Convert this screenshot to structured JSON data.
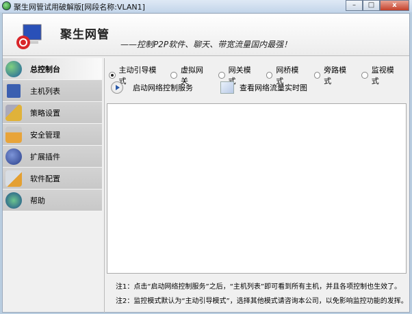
{
  "window": {
    "title": "聚生网管试用破解版[网段名称:VLAN1]",
    "minimize": "–",
    "maximize": "□",
    "close": "x"
  },
  "header": {
    "app_name": "聚生网管",
    "slogan": "——控制P2P软件、聊天、带宽流量国内最强！"
  },
  "sidebar": {
    "items": [
      {
        "label": "总控制台",
        "icon": "globe-icon",
        "color": "#2f7a3a"
      },
      {
        "label": "主机列表",
        "icon": "monitor-star-icon",
        "color": "#3b5fb0"
      },
      {
        "label": "策略设置",
        "icon": "keys-icon",
        "color": "#e0b23a"
      },
      {
        "label": "安全管理",
        "icon": "padlock-icon",
        "color": "#e8a43a"
      },
      {
        "label": "扩展插件",
        "icon": "plugin-icon",
        "color": "#3a57a8"
      },
      {
        "label": "软件配置",
        "icon": "config-icon",
        "color": "#9aa4ae"
      },
      {
        "label": "帮助",
        "icon": "help-icon",
        "color": "#2f8a5a"
      }
    ]
  },
  "modes": [
    {
      "label": "主动引导模式",
      "selected": true
    },
    {
      "label": "虚拟网关",
      "selected": false
    },
    {
      "label": "网关模式",
      "selected": false
    },
    {
      "label": "网桥模式",
      "selected": false
    },
    {
      "label": "旁路模式",
      "selected": false
    },
    {
      "label": "监视模式",
      "selected": false
    }
  ],
  "actions": {
    "start_service": "启动网络控制服务",
    "view_traffic": "查看网络流量实时图"
  },
  "notes": [
    "注1：点击“启动网络控制服务”之后，“主机列表”即可看到所有主机，并且各项控制也生效了。",
    "注2：监控模式默认为“主动引导模式”，选择其他模式请咨询本公司，以免影响监控功能的发挥。"
  ]
}
